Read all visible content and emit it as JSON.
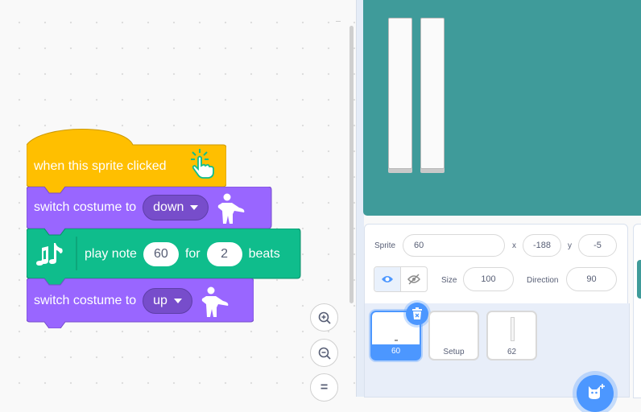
{
  "workspace": {
    "blocks": {
      "hat": {
        "label": "when this sprite clicked"
      },
      "switch_down": {
        "label": "switch costume to",
        "costume": "down"
      },
      "play_note": {
        "label": "play note",
        "note": "60",
        "for_label": "for",
        "beats": "2",
        "beats_label": "beats"
      },
      "switch_up": {
        "label": "switch costume to",
        "costume": "up"
      }
    },
    "zoom": {
      "zoom_in": "zoom-in",
      "zoom_out": "zoom-out",
      "reset": "="
    }
  },
  "sprite_info": {
    "sprite_label": "Sprite",
    "sprite_name": "60",
    "x_label": "x",
    "x_value": "-188",
    "y_label": "y",
    "y_value": "-5",
    "size_label": "Size",
    "size_value": "100",
    "direction_label": "Direction",
    "direction_value": "90"
  },
  "sprites": [
    {
      "name": "60",
      "selected": true
    },
    {
      "name": "Setup",
      "selected": false
    },
    {
      "name": "62",
      "selected": false
    }
  ],
  "colors": {
    "events": "#ffbf00",
    "looks": "#9966ff",
    "music": "#0fbd8c",
    "stage": "#3f9b9a",
    "accent": "#4c97ff"
  }
}
